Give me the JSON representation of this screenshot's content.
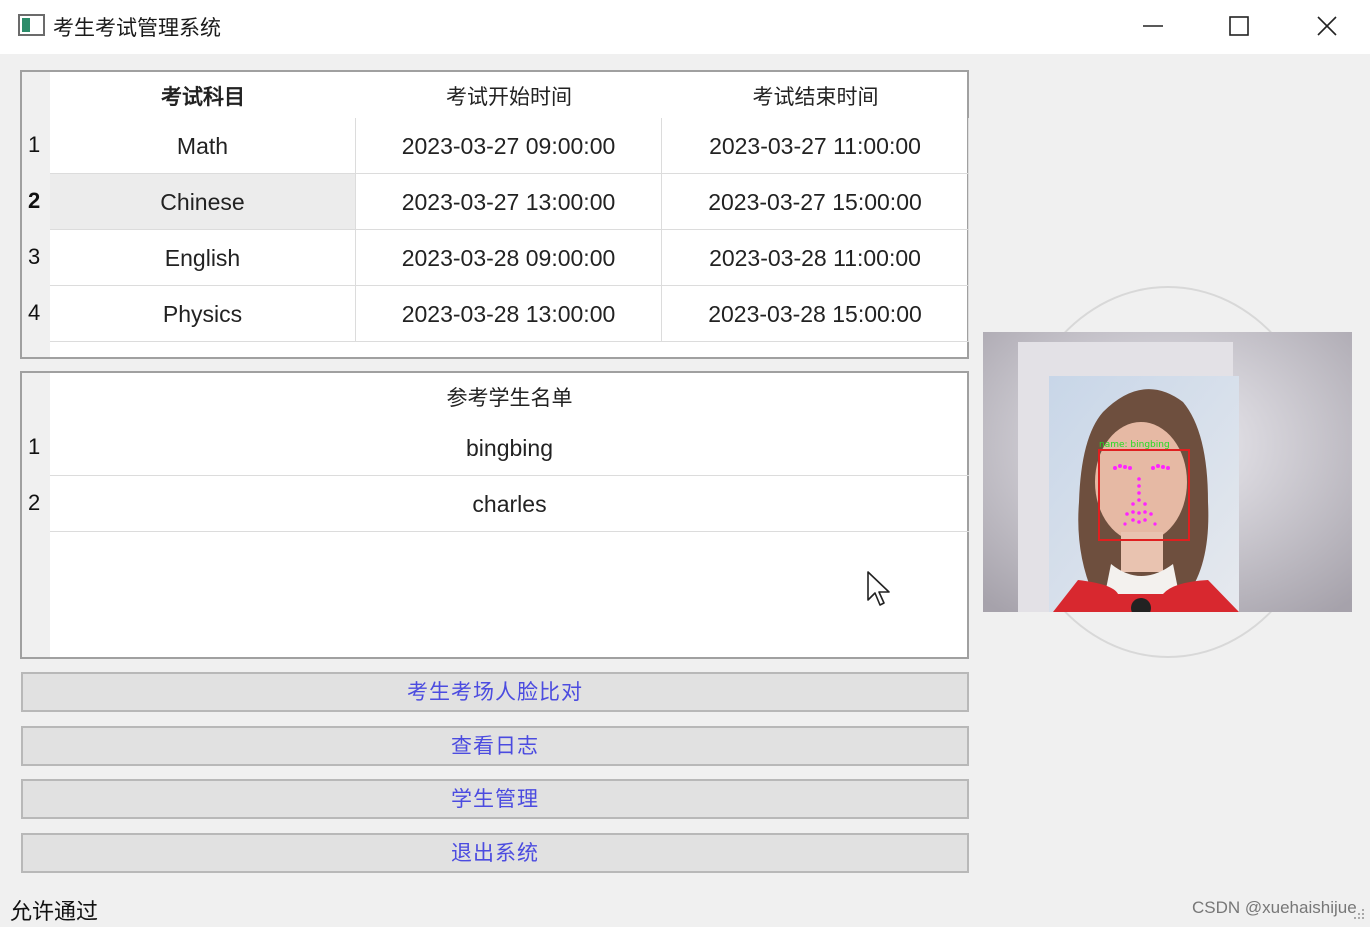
{
  "window": {
    "title": "考生考试管理系统"
  },
  "exam_table": {
    "headers": [
      "考试科目",
      "考试开始时间",
      "考试结束时间"
    ],
    "rows": [
      {
        "num": "1",
        "subject": "Math",
        "start": "2023-03-27 09:00:00",
        "end": "2023-03-27 11:00:00"
      },
      {
        "num": "2",
        "subject": "Chinese",
        "start": "2023-03-27 13:00:00",
        "end": "2023-03-27 15:00:00"
      },
      {
        "num": "3",
        "subject": "English",
        "start": "2023-03-28 09:00:00",
        "end": "2023-03-28 11:00:00"
      },
      {
        "num": "4",
        "subject": "Physics",
        "start": "2023-03-28 13:00:00",
        "end": "2023-03-28 15:00:00"
      }
    ],
    "selected_row": 2
  },
  "student_table": {
    "header": "参考学生名单",
    "rows": [
      {
        "num": "1",
        "name": "bingbing"
      },
      {
        "num": "2",
        "name": "charles"
      }
    ]
  },
  "buttons": {
    "face_compare": "考生考场人脸比对",
    "view_log": "查看日志",
    "student_manage": "学生管理",
    "exit": "退出系统"
  },
  "status": {
    "text": "允许通过"
  },
  "camera": {
    "face_label": "name: bingbing",
    "box_color": "#e02020",
    "label_color": "#22dd22",
    "landmark_color": "#ff22ff"
  },
  "watermark": "CSDN @xuehaishijue"
}
